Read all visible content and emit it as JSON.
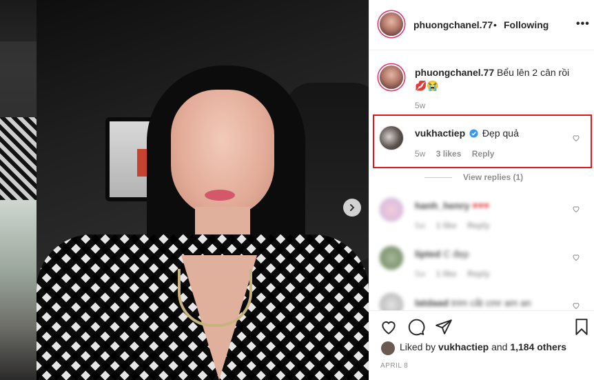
{
  "post": {
    "username": "phuongchanel.77",
    "separator": "•",
    "following_label": "Following",
    "more_icon": "more-icon",
    "caption": {
      "username": "phuongchanel.77",
      "text": "Bểu lên 2 cân rồi",
      "emoji": "💋😭",
      "time": "5w"
    }
  },
  "highlighted_comment": {
    "username": "vukhactiep",
    "verified_icon": "verified-badge-icon",
    "text": "Đẹp quả",
    "time": "5w",
    "likes": "3 likes",
    "reply": "Reply"
  },
  "view_replies": "View replies (1)",
  "blurred_comments": [
    {
      "username": "hanh_henry",
      "text": "♥♥♥",
      "time": "5w",
      "likes": "1 like",
      "reply": "Reply"
    },
    {
      "username": "lipted",
      "text": "C đẹp",
      "time": "5w",
      "likes": "1 like",
      "reply": "Reply"
    },
    {
      "username": "latdaad",
      "text": "trim cắt cmr am an",
      "time": "",
      "likes": "",
      "reply": ""
    }
  ],
  "liked_by": {
    "prefix": "Liked by",
    "user": "vukhactiep",
    "and": "and",
    "others": "1,184 others"
  },
  "date": "APRIL 8",
  "colors": {
    "highlight_border": "#e1161b",
    "story_ring": "#e1306c",
    "verified": "#3897f0",
    "muted": "#8e8e8e"
  }
}
